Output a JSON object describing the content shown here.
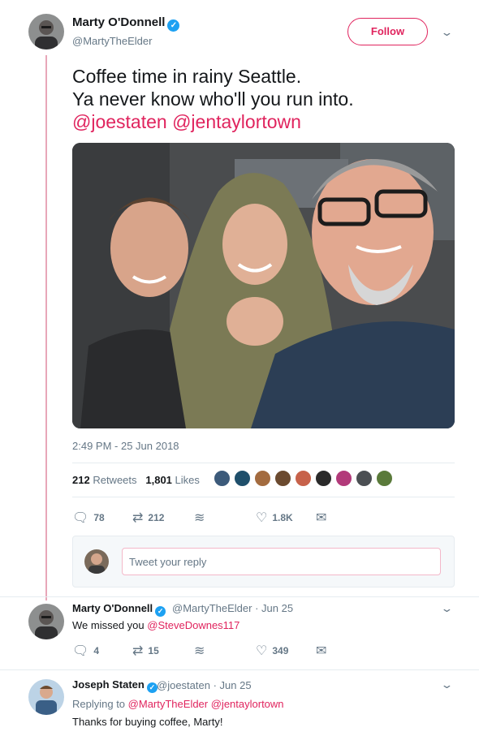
{
  "main_tweet": {
    "author_name": "Marty O'Donnell",
    "author_handle": "@MartyTheElder",
    "follow_label": "Follow",
    "text_line1": "Coffee time in rainy Seattle.",
    "text_line2": "Ya never know who'll you run into.",
    "mentions": "@joestaten @jentaylortown",
    "timestamp": "2:49 PM - 25 Jun 2018",
    "retweets_count": "212",
    "retweets_label": "Retweets",
    "likes_count": "1,801",
    "likes_label": "Likes",
    "actions": {
      "reply": "78",
      "retweet": "212",
      "like": "1.8K"
    }
  },
  "reply_box": {
    "placeholder": "Tweet your reply"
  },
  "replies": [
    {
      "author_name": "Marty O'Donnell",
      "author_handle": "@MartyTheElder",
      "date": "· Jun 25",
      "text_prefix": "We missed you",
      "text_mention": "@SteveDownes117",
      "actions": {
        "reply": "4",
        "retweet": "15",
        "like": "349"
      }
    },
    {
      "author_name": "Joseph Staten",
      "author_handle": "@joestaten",
      "date": "· Jun 25",
      "replying_prefix": "Replying to",
      "replying_to": "@MartyTheElder @jentaylortown",
      "text": "Thanks for buying coffee, Marty!"
    }
  ],
  "colors": {
    "accent": "#e0245e",
    "verified": "#1da1f2",
    "muted": "#657786",
    "thread_line": "#e8a7b9"
  },
  "icons": [
    "verified-icon",
    "chevron-down-icon",
    "reply-icon",
    "retweet-icon",
    "stack-icon",
    "heart-icon",
    "message-icon"
  ]
}
